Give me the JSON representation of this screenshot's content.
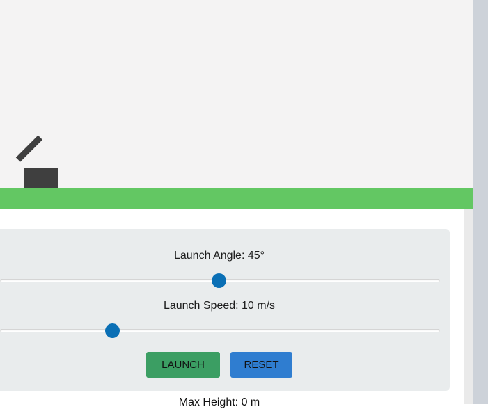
{
  "controls": {
    "angle_label": "Launch Angle: 45°",
    "angle_value": 45,
    "speed_label": "Launch Speed: 10 m/s",
    "speed_value": 10
  },
  "buttons": {
    "launch_label": "LAUNCH",
    "reset_label": "RESET"
  },
  "stats": {
    "max_height": "Max Height: 0 m"
  },
  "colors": {
    "sky": "#f4f3f3",
    "ground": "#63c763",
    "cannon": "#3f3f3f",
    "panel": "#e9eced",
    "slider_thumb": "#0a6fb5",
    "launch_button": "#3b9e63",
    "reset_button": "#2f7dd0"
  }
}
